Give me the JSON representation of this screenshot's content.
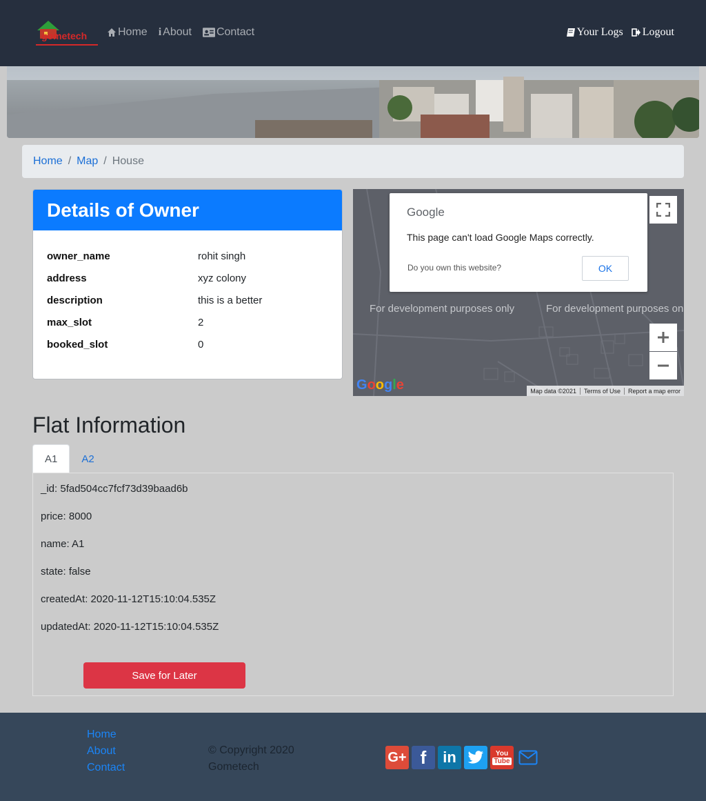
{
  "nav": {
    "logo_text": "Gometech",
    "links": [
      {
        "label": "Home",
        "icon": "home-icon"
      },
      {
        "label": "About",
        "icon": "info-icon"
      },
      {
        "label": "Contact",
        "icon": "contact-card-icon"
      }
    ],
    "right_links": [
      {
        "label": "Your Logs",
        "icon": "book-icon"
      },
      {
        "label": "Logout",
        "icon": "sign-out-icon"
      }
    ]
  },
  "breadcrumb": {
    "items": [
      "Home",
      "Map"
    ],
    "active": "House"
  },
  "owner": {
    "title": "Details of Owner",
    "rows": [
      {
        "key": "owner_name",
        "value": "rohit singh"
      },
      {
        "key": "address",
        "value": "xyz colony"
      },
      {
        "key": "description",
        "value": "this is a better"
      },
      {
        "key": "max_slot",
        "value": "2"
      },
      {
        "key": "booked_slot",
        "value": "0"
      }
    ]
  },
  "map": {
    "brand": "Google",
    "error_message": "This page can't load Google Maps correctly.",
    "own_question": "Do you own this website?",
    "ok_label": "OK",
    "dev_watermark": "For development purposes only",
    "attribution": [
      "Map data ©2021",
      "Terms of Use",
      "Report a map error"
    ],
    "logo": "Google"
  },
  "flat": {
    "title": "Flat Information",
    "tabs": [
      "A1",
      "A2"
    ],
    "fields": [
      "_id: 5fad504cc7fcf73d39baad6b",
      "price: 8000",
      "name: A1",
      "state: false",
      "createdAt: 2020-11-12T15:10:04.535Z",
      "updatedAt: 2020-11-12T15:10:04.535Z"
    ],
    "save_label": "Save for Later"
  },
  "footer": {
    "links": [
      "Home",
      "About",
      "Contact"
    ],
    "copyright": "© Copyright 2020 Gometech",
    "social": [
      {
        "name": "google-plus-icon",
        "color": "#dd4b39"
      },
      {
        "name": "facebook-icon",
        "color": "#3b5998"
      },
      {
        "name": "linkedin-icon",
        "color": "#0e76a8"
      },
      {
        "name": "twitter-icon",
        "color": "#1da1f2"
      },
      {
        "name": "youtube-icon",
        "color": "#d9392c"
      },
      {
        "name": "email-icon",
        "color": "#1b85f7"
      }
    ]
  }
}
